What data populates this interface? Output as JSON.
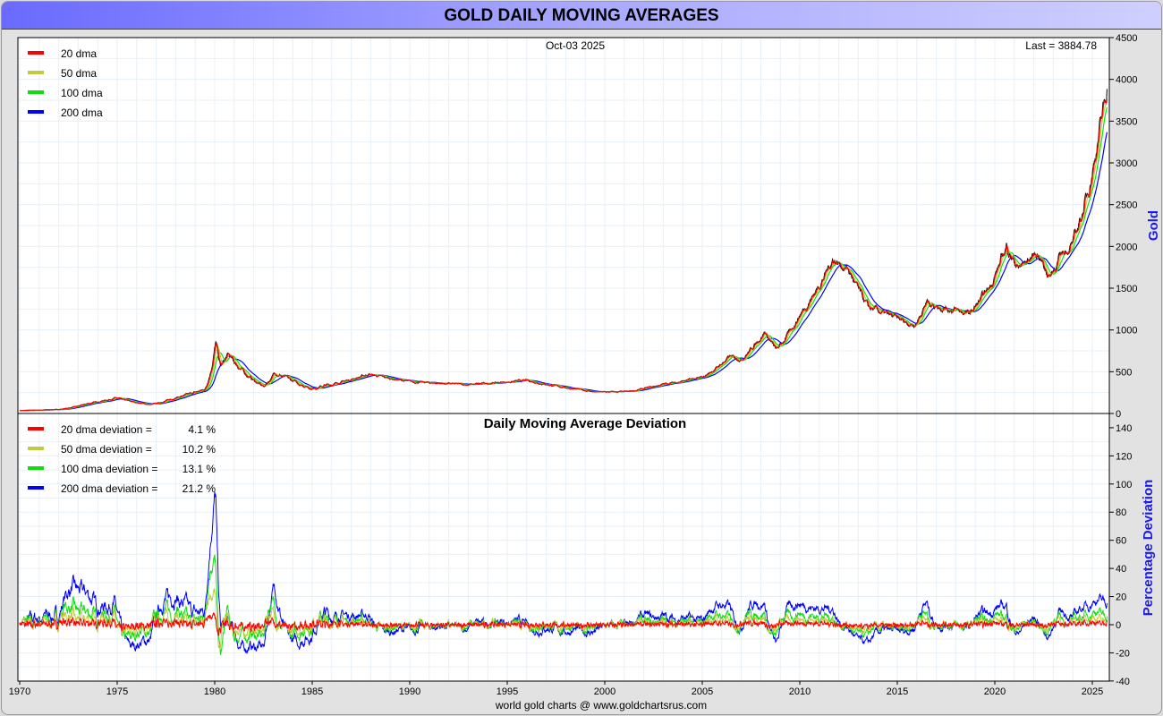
{
  "title": "GOLD DAILY MOVING AVERAGES",
  "footer": "world gold charts @ www.goldchartsrus.com",
  "chart_data": [
    {
      "type": "line",
      "title": "",
      "date_label": "Oct-03  2025",
      "last_label": "Last = 3884.78",
      "ylabel": "Gold",
      "ylim": [
        0,
        4500
      ],
      "yticks": [
        0,
        500,
        1000,
        1500,
        2000,
        2500,
        3000,
        3500,
        4000,
        4500
      ],
      "xlim": [
        1970,
        2025.75
      ],
      "xticks": [
        1970,
        1975,
        1980,
        1985,
        1990,
        1995,
        2000,
        2005,
        2010,
        2015,
        2020,
        2025
      ],
      "legend": [
        {
          "label": "20 dma",
          "color": "#ff0000",
          "window": 20
        },
        {
          "label": "50 dma",
          "color": "#bfcc40",
          "window": 50
        },
        {
          "label": "100 dma",
          "color": "#10dd10",
          "window": 100
        },
        {
          "label": "200 dma",
          "color": "#0000ff",
          "window": 200
        }
      ],
      "price_color": "#000000",
      "price_keypoints": [
        [
          1970,
          35
        ],
        [
          1972,
          48
        ],
        [
          1973.5,
          120
        ],
        [
          1974.9,
          185
        ],
        [
          1976.7,
          105
        ],
        [
          1978,
          190
        ],
        [
          1979.5,
          290
        ],
        [
          1980.05,
          850
        ],
        [
          1980.3,
          560
        ],
        [
          1980.7,
          700
        ],
        [
          1982.5,
          320
        ],
        [
          1983.1,
          490
        ],
        [
          1985,
          300
        ],
        [
          1987.9,
          470
        ],
        [
          1990,
          380
        ],
        [
          1993,
          345
        ],
        [
          1996,
          395
        ],
        [
          1999.6,
          255
        ],
        [
          2001.2,
          260
        ],
        [
          2003,
          350
        ],
        [
          2005,
          430
        ],
        [
          2006.4,
          680
        ],
        [
          2007,
          650
        ],
        [
          2008.2,
          980
        ],
        [
          2008.8,
          760
        ],
        [
          2010,
          1180
        ],
        [
          2011.7,
          1850
        ],
        [
          2012.5,
          1720
        ],
        [
          2013.5,
          1270
        ],
        [
          2015.9,
          1060
        ],
        [
          2016.5,
          1330
        ],
        [
          2018.7,
          1190
        ],
        [
          2019.7,
          1500
        ],
        [
          2020.6,
          2000
        ],
        [
          2021.2,
          1740
        ],
        [
          2022.2,
          1930
        ],
        [
          2022.8,
          1640
        ],
        [
          2023.5,
          1930
        ],
        [
          2024,
          2030
        ],
        [
          2024.8,
          2680
        ],
        [
          2025.3,
          3300
        ],
        [
          2025.75,
          3884.78
        ]
      ]
    },
    {
      "type": "line",
      "title": "Daily Moving Average Deviation",
      "ylabel": "Percentage Deviation",
      "ylim": [
        -40,
        140
      ],
      "yticks": [
        -40,
        -20,
        0,
        20,
        40,
        60,
        80,
        100,
        120,
        140
      ],
      "legend": [
        {
          "label": "20 dma deviation =",
          "value": "4.1 %",
          "color": "#ff0000"
        },
        {
          "label": "50 dma deviation =",
          "value": "10.2 %",
          "color": "#bfcc40"
        },
        {
          "label": "100 dma deviation =",
          "value": "13.1 %",
          "color": "#10dd10"
        },
        {
          "label": "200 dma deviation =",
          "value": "21.2 %",
          "color": "#0000ff"
        }
      ]
    }
  ]
}
